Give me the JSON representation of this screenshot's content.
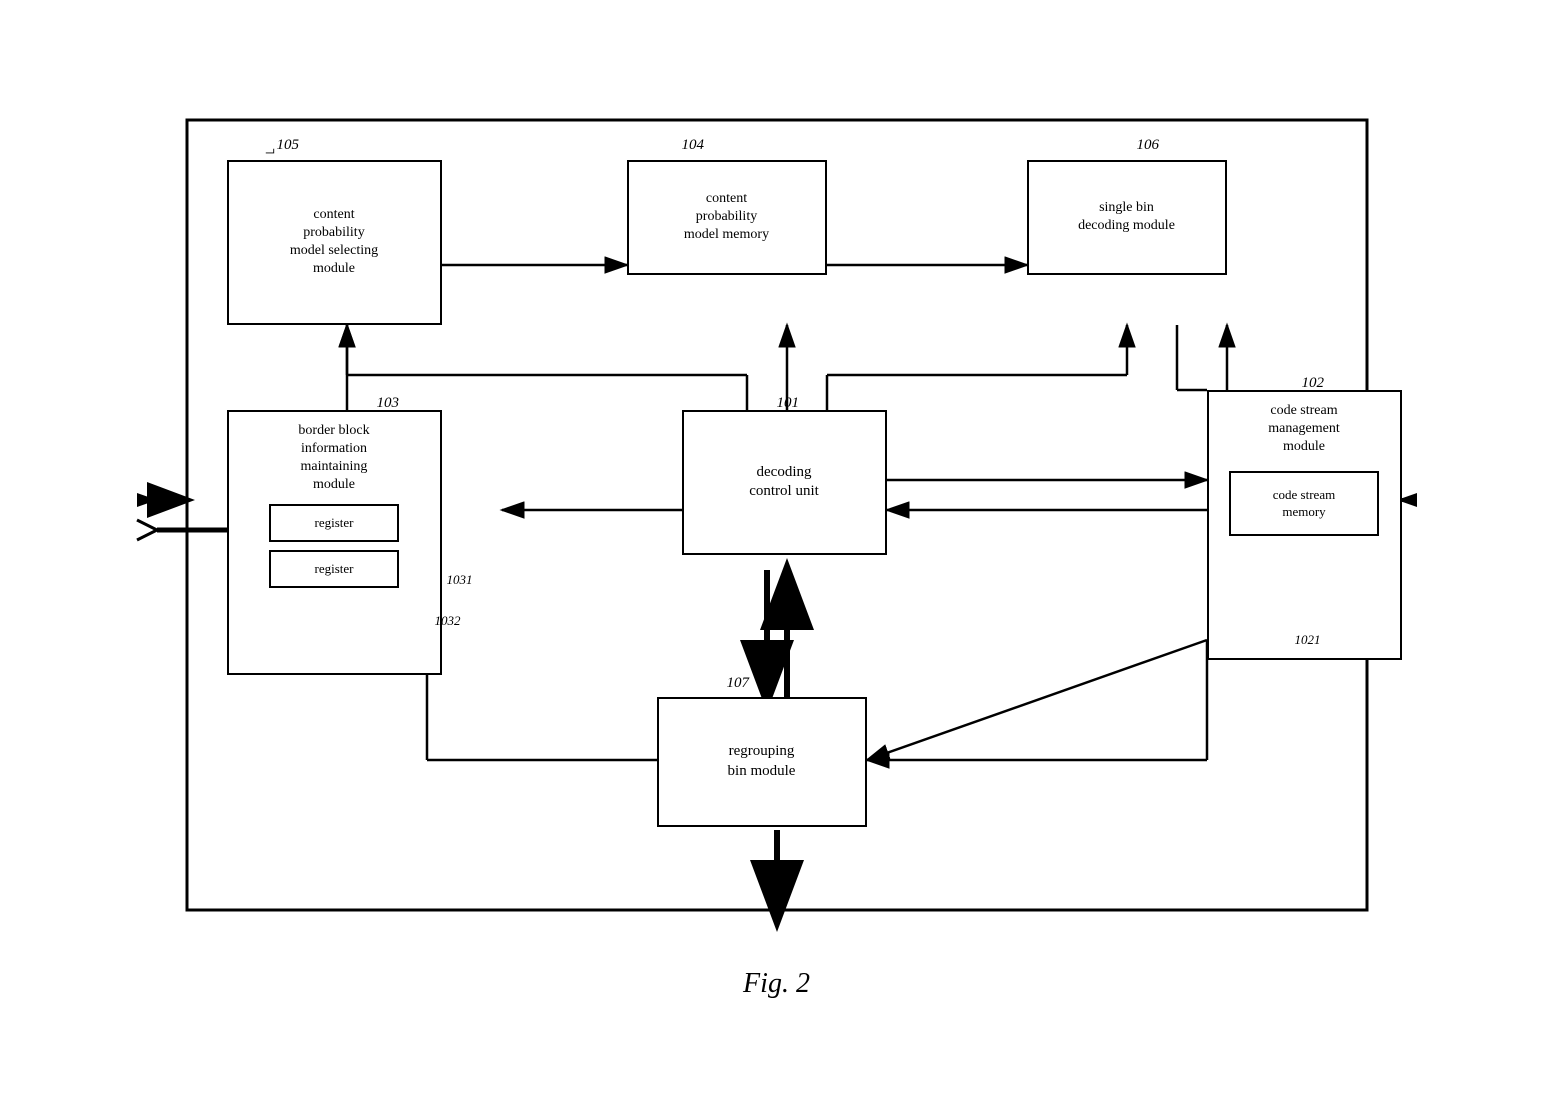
{
  "figure": {
    "caption": "Fig. 2",
    "outer_box": {
      "label": ""
    },
    "modules": {
      "content_prob_selecting": {
        "label": "content\nprobability\nmodel selecting\nmodule",
        "ref": "105"
      },
      "content_prob_memory": {
        "label": "content\nprobability\nmodel memory",
        "ref": "104"
      },
      "single_bin_decoding": {
        "label": "single bin\ndecoding module",
        "ref": "106"
      },
      "border_block": {
        "label": "border block\ninformation\nmaintaining\nmodule",
        "ref": "103"
      },
      "register1": {
        "label": "register",
        "ref": "1031"
      },
      "register2": {
        "label": "register",
        "ref": "1032"
      },
      "decoding_control": {
        "label": "decoding\ncontrol unit",
        "ref": "101"
      },
      "code_stream_mgmt": {
        "label": "code stream\nmanagement\nmodule",
        "ref": "102"
      },
      "code_stream_memory": {
        "label": "code stream\nmemory",
        "ref": "1021"
      },
      "regrouping_bin": {
        "label": "regrouping\nbin module",
        "ref": "107"
      }
    }
  }
}
